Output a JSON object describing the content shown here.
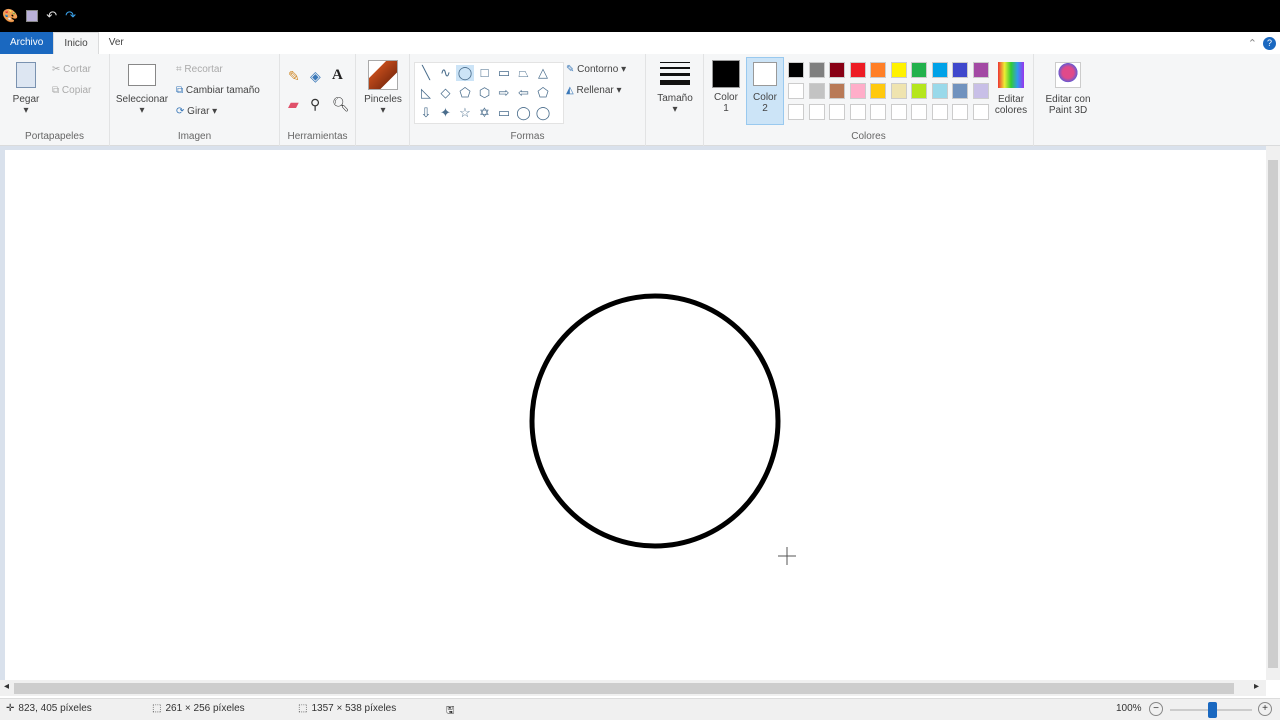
{
  "quick_access": {
    "undo_icon": "↶",
    "redo_icon": "↷"
  },
  "tabs": {
    "file": "Archivo",
    "home": "Inicio",
    "view": "Ver"
  },
  "clipboard": {
    "paste": "Pegar",
    "cut": "Cortar",
    "copy": "Copiar",
    "label": "Portapapeles"
  },
  "image": {
    "select": "Seleccionar",
    "crop": "Recortar",
    "resize": "Cambiar tamaño",
    "rotate": "Girar",
    "label": "Imagen"
  },
  "tools": {
    "label": "Herramientas",
    "text_icon": "A"
  },
  "brushes": {
    "label": "Pinceles"
  },
  "shapes": {
    "outline": "Contorno",
    "fill": "Rellenar",
    "label": "Formas",
    "glyphs": [
      "╲",
      "∿",
      "◯",
      "□",
      "▭",
      "⏢",
      "△",
      "◺",
      "◇",
      "⬠",
      "⬡",
      "⇨",
      "⇦",
      "⬠",
      "⇩",
      "✦",
      "☆",
      "✡",
      "▭",
      "◯",
      "◯"
    ]
  },
  "size": {
    "label": "Tamaño"
  },
  "colors": {
    "color1": "Color 1",
    "color2": "Color 2",
    "edit": "Editar colores",
    "paint3d": "Editar con Paint 3D",
    "label": "Colores",
    "color1_value": "#000000",
    "color2_value": "#ffffff",
    "palette_row1": [
      "#000000",
      "#7f7f7f",
      "#880015",
      "#ed1c24",
      "#ff7f27",
      "#fff200",
      "#22b14c",
      "#00a2e8",
      "#3f48cc",
      "#a349a4"
    ],
    "palette_row2": [
      "#ffffff",
      "#c3c3c3",
      "#b97a57",
      "#ffaec9",
      "#ffc90e",
      "#efe4b0",
      "#b5e61d",
      "#99d9ea",
      "#7092be",
      "#c8bfe7"
    ]
  },
  "status": {
    "cursor": "823, 405 píxeles",
    "selection": "261 × 256 píxeles",
    "canvas_size": "1357 × 538 píxeles",
    "zoom": "100%"
  }
}
